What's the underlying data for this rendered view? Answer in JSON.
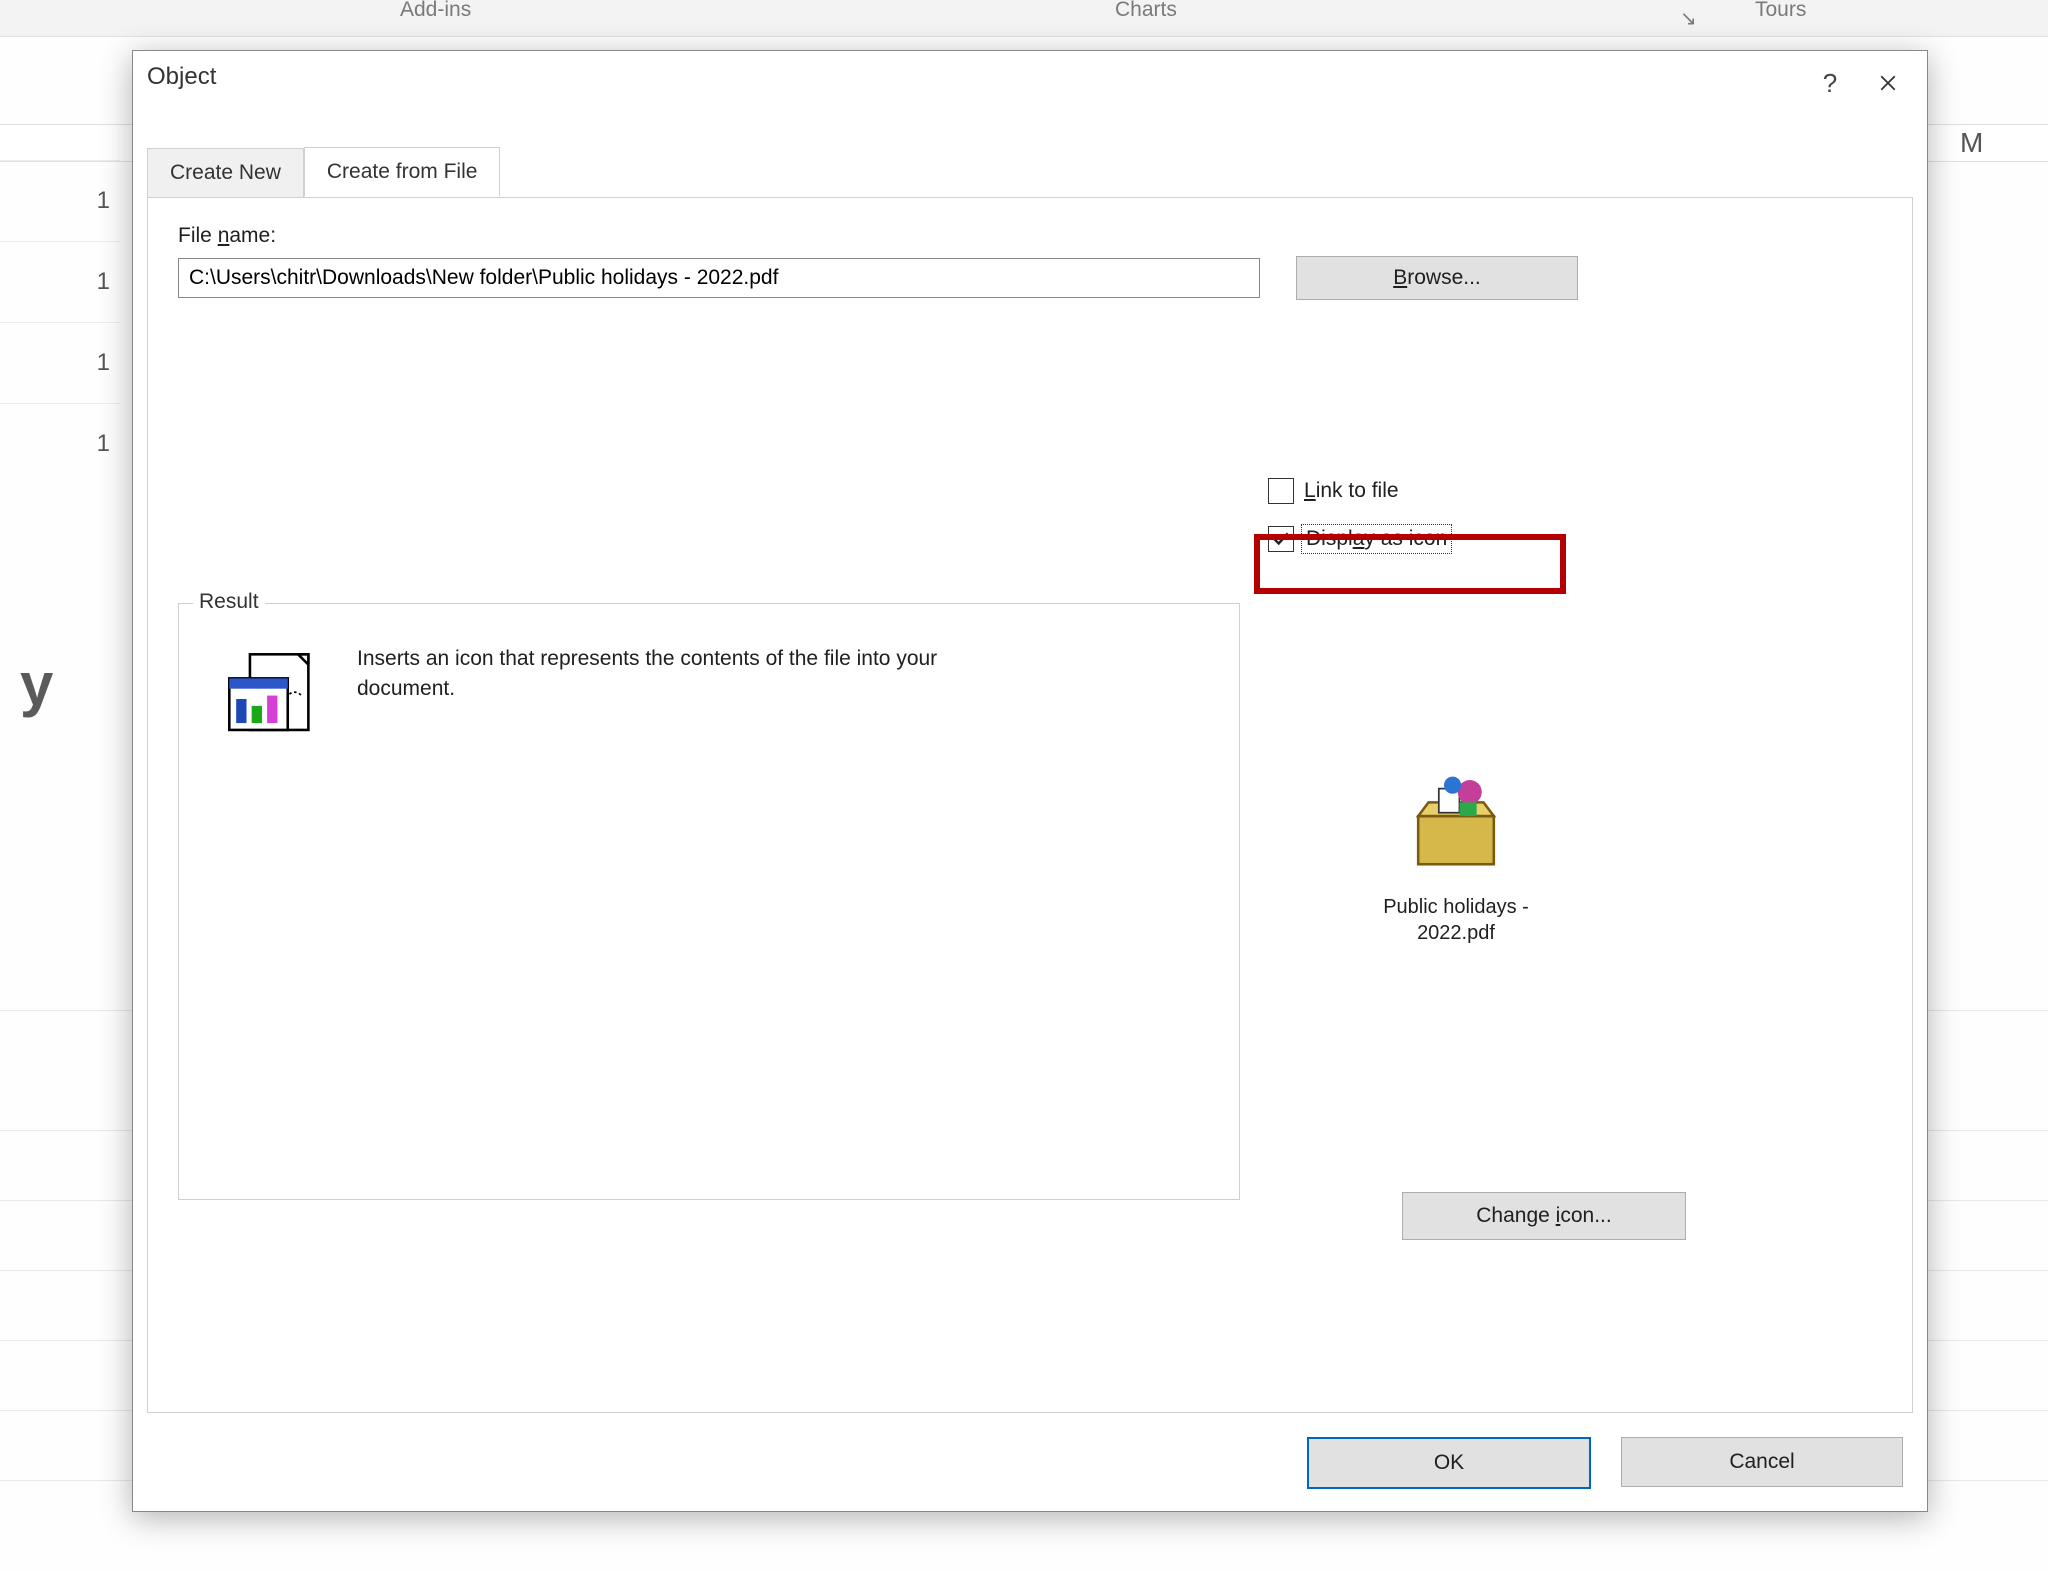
{
  "bg": {
    "ribbon_addins": "Add-ins",
    "ribbon_charts": "Charts",
    "ribbon_tours": "Tours",
    "col_M": "M",
    "row_1a": "1",
    "row_1b": "1",
    "row_1c": "1",
    "row_1d": "1",
    "ylabel": "y"
  },
  "dialog": {
    "title": "Object",
    "tabs": {
      "create_new": "Create New",
      "create_from_file": "Create from File"
    },
    "file_label": "File name:",
    "file_value": "C:\\Users\\chitr\\Downloads\\New folder\\Public holidays - 2022.pdf",
    "browse": "Browse...",
    "browse_ul": "B",
    "link_to_file": "Link to file",
    "link_ul": "L",
    "display_as_icon": "Display as icon",
    "display_ul": "a",
    "result_legend": "Result",
    "result_desc": "Inserts an icon that represents the contents of the file into your document.",
    "preview_caption": "Public holidays - 2022.pdf",
    "change_icon": "Change icon...",
    "change_ul": "i",
    "ok": "OK",
    "cancel": "Cancel"
  }
}
